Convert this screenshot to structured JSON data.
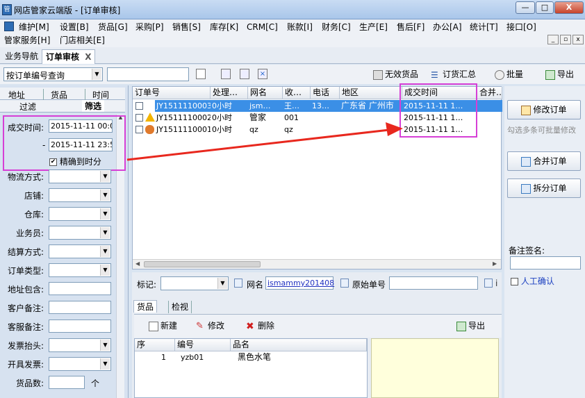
{
  "window": {
    "title": "网店管家云端版 - [订单审核]",
    "minimize": "—",
    "maximize": "□",
    "close": "X"
  },
  "menu": {
    "row1": [
      "维护[M]",
      "设置[B]",
      "货品[G]",
      "采购[P]",
      "销售[S]",
      "库存[K]",
      "CRM[C]",
      "账款[I]",
      "财务[C]",
      "生产[E]",
      "售后[F]",
      "办公[A]",
      "统计[T]",
      "接口[O]"
    ],
    "row2": [
      "管家服务[H]",
      "门店相关[E]"
    ]
  },
  "tabs": {
    "nav": "业务导航",
    "active": "订单审核",
    "close": "X"
  },
  "toolbar": {
    "query_type": "按订单编号查询",
    "query_value": "",
    "invalid_goods": "无效货品",
    "order_summary": "订货汇总",
    "batch": "批量",
    "export": "导出"
  },
  "left": {
    "tabs": [
      "地址",
      "货品",
      "时间"
    ],
    "tabs2": [
      "过滤",
      "筛选"
    ],
    "trade_time_label": "成交时间:",
    "time_from": "2015-11-11 00:0",
    "dash": "-",
    "time_to": "2015-11-11 23:5",
    "precise_label": "精确到时分",
    "precise_checked": "✔",
    "filters": [
      "物流方式:",
      "店铺:",
      "仓库:",
      "业务员:",
      "结算方式:",
      "订单类型:",
      "地址包含:",
      "客户备注:",
      "客服备注:",
      "发票抬头:",
      "开具发票:",
      "货品数:"
    ],
    "goods_count_unit": "个"
  },
  "grid": {
    "columns": [
      "订单号",
      "处理…",
      "网名",
      "收…",
      "电话",
      "地区",
      "成交时间",
      "合并…"
    ],
    "rows": [
      {
        "order_no": "JY1511110003",
        "process": "0小时",
        "nick": "jsm…",
        "receiver": "王…",
        "phone": "13…",
        "region": "广东省 广州市",
        "time": "2015-11-11 1…",
        "selected": true
      },
      {
        "order_no": "JY1511110002",
        "process": "0小时",
        "nick": "管家",
        "receiver": "001",
        "phone": "",
        "region": "",
        "time": "2015-11-11 1…",
        "selected": false
      },
      {
        "order_no": "JY1511110001",
        "process": "0小时",
        "nick": "qz",
        "receiver": "qz",
        "phone": "",
        "region": "",
        "time": "2015-11-11 1…",
        "selected": false
      }
    ]
  },
  "details": {
    "mark_label": "标记:",
    "nick_label": "网名",
    "nick_value": "ismammy201408",
    "orig_no_label": "原始单号",
    "extra_label": "i",
    "tabs": [
      "货品",
      "检视"
    ],
    "new": "新建",
    "edit": "修改",
    "delete": "删除",
    "export": "导出",
    "columns": [
      "序",
      "编号",
      "品名"
    ],
    "rows": [
      {
        "seq": "1",
        "code": "yzb01",
        "name": "黑色水笔"
      }
    ]
  },
  "right": {
    "modify_order": "修改订单",
    "batch_hint": "勾选多条可批量修改",
    "merge_order": "合并订单",
    "split_order": "拆分订单",
    "note_label": "备注签名:",
    "manual_confirm": "人工确认"
  },
  "colors": {
    "highlight": "#d63fd6",
    "arrow": "#e8281e",
    "selection": "#3b8fe6"
  }
}
